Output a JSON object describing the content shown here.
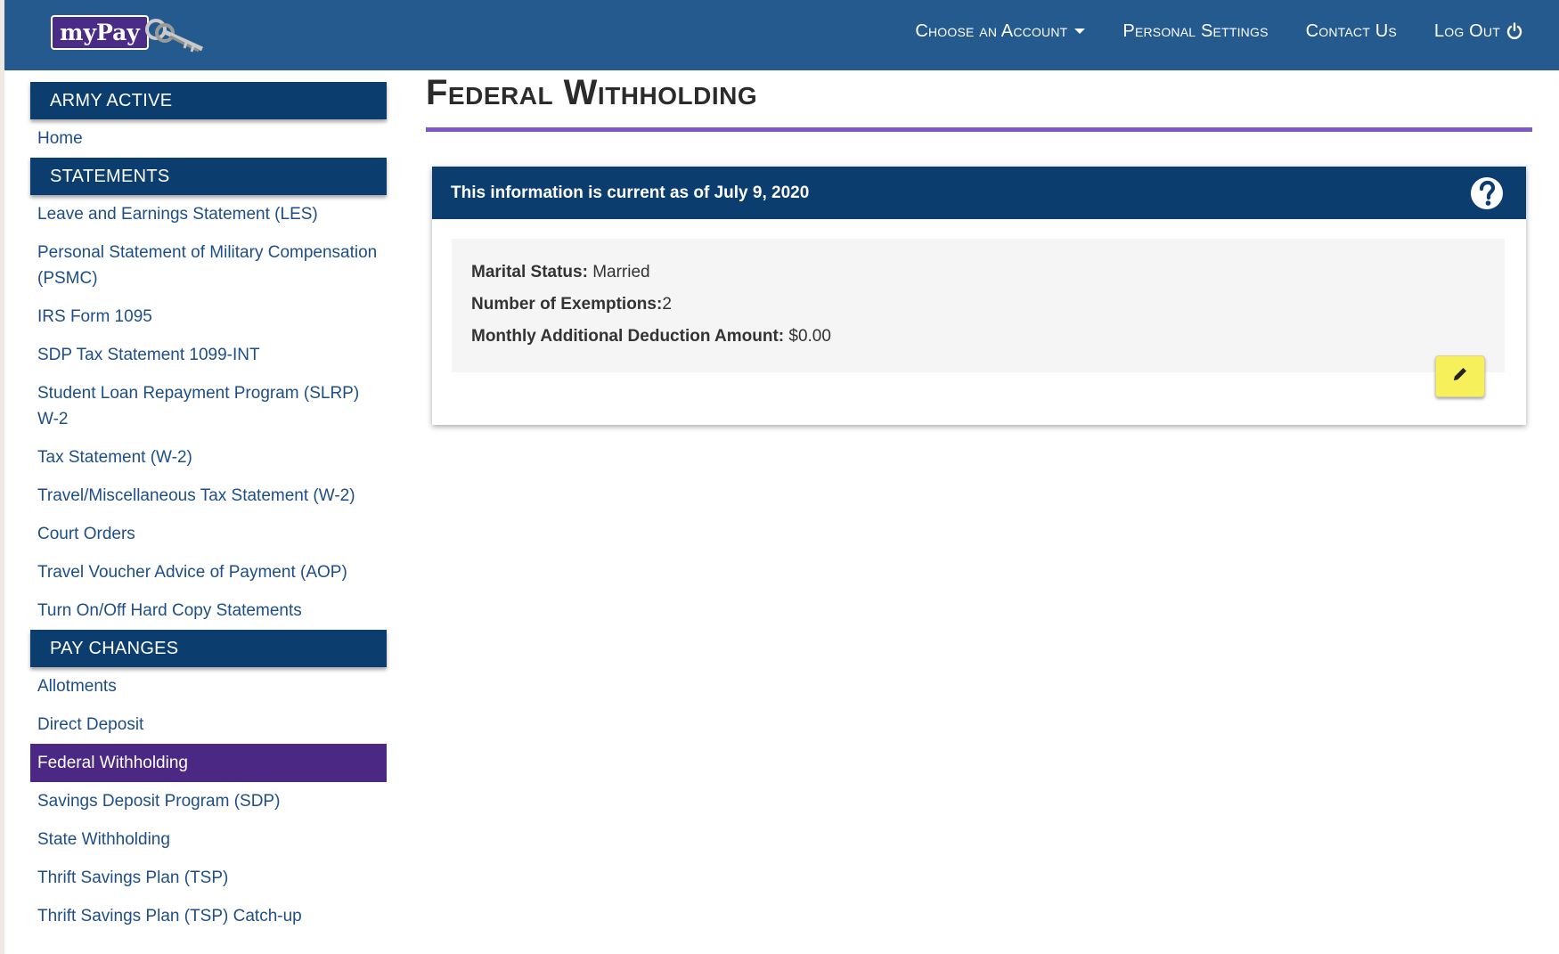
{
  "app": {
    "logo_text": "myPay",
    "colors": {
      "topbar": "#245a8e",
      "sidebar_header": "#0b3d6f",
      "active_item": "#4b2883",
      "title_rule": "#7e59c8",
      "edit_button": "#f6f05a"
    }
  },
  "topnav": {
    "choose_account": "Choose an Account",
    "personal_settings": "Personal Settings",
    "contact_us": "Contact Us",
    "log_out": "Log Out",
    "icons": {
      "dropdown": "caret-down-icon",
      "logout": "power-icon"
    }
  },
  "sidebar": {
    "account_header": "ARMY ACTIVE",
    "home": "Home",
    "statements_header": "STATEMENTS",
    "statements": [
      "Leave and Earnings Statement (LES)",
      "Personal Statement of Military Compensation (PSMC)",
      "IRS Form 1095",
      "SDP Tax Statement 1099-INT",
      "Student Loan Repayment Program (SLRP) W-2",
      "Tax Statement (W-2)",
      "Travel/Miscellaneous Tax Statement (W-2)",
      "Court Orders",
      "Travel Voucher Advice of Payment (AOP)",
      "Turn On/Off Hard Copy Statements"
    ],
    "pay_changes_header": "PAY CHANGES",
    "pay_changes": [
      "Allotments",
      "Direct Deposit",
      "Federal Withholding",
      "Savings Deposit Program (SDP)",
      "State Withholding",
      "Thrift Savings Plan (TSP)",
      "Thrift Savings Plan (TSP) Catch-up"
    ],
    "active_item": "Federal Withholding"
  },
  "main": {
    "title": "Federal Withholding",
    "card": {
      "header": "This information is current as of July 9, 2020",
      "help_icon": "question-circle-icon",
      "marital_status_label": "Marital Status:",
      "marital_status_value": "Married",
      "exemptions_label": "Number of Exemptions:",
      "exemptions_value": "2",
      "deduction_label": "Monthly Additional Deduction Amount:",
      "deduction_value": "$0.00",
      "edit_icon": "pencil-icon"
    }
  }
}
